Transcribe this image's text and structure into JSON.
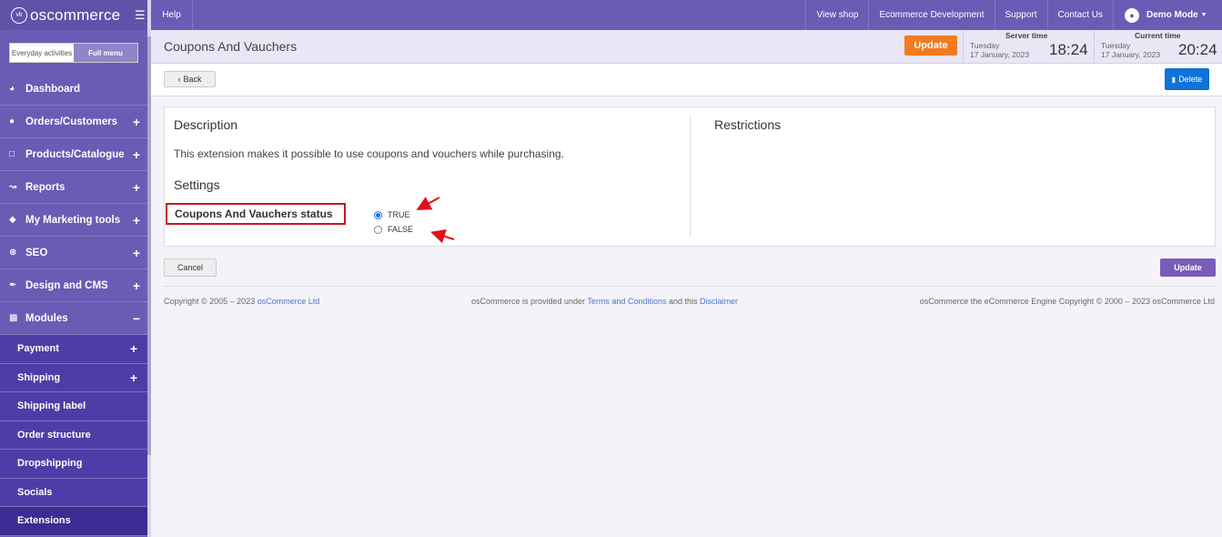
{
  "brand": {
    "name": "oscommerce",
    "logo_text": "vk"
  },
  "menu_toggle": {
    "everyday": "Everyday activities",
    "full": "Full menu"
  },
  "sidebar": {
    "items": [
      {
        "label": "Dashboard",
        "icon": "dashboard-icon",
        "expand": ""
      },
      {
        "label": "Orders/Customers",
        "icon": "users-icon",
        "expand": "+"
      },
      {
        "label": "Products/Catalogue",
        "icon": "folder-icon",
        "expand": "+"
      },
      {
        "label": "Reports",
        "icon": "chart-icon",
        "expand": "+"
      },
      {
        "label": "My Marketing tools",
        "icon": "tag-icon",
        "expand": "+"
      },
      {
        "label": "SEO",
        "icon": "sitemap-icon",
        "expand": "+"
      },
      {
        "label": "Design and CMS",
        "icon": "brush-icon",
        "expand": "+"
      },
      {
        "label": "Modules",
        "icon": "puzzle-icon",
        "expand": "−"
      }
    ],
    "subitems": [
      {
        "label": "Payment",
        "expand": "+"
      },
      {
        "label": "Shipping",
        "expand": "+"
      },
      {
        "label": "Shipping label",
        "expand": ""
      },
      {
        "label": "Order structure",
        "expand": ""
      },
      {
        "label": "Dropshipping",
        "expand": ""
      },
      {
        "label": "Socials",
        "expand": ""
      },
      {
        "label": "Extensions",
        "expand": ""
      }
    ]
  },
  "topbar": {
    "help": "Help",
    "links": [
      "View shop",
      "Ecommerce Development",
      "Support",
      "Contact Us"
    ],
    "user": "Demo Mode"
  },
  "header": {
    "title": "Coupons And Vauchers",
    "update": "Update",
    "server": {
      "label": "Server time",
      "day": "Tuesday",
      "date": "17 January, 2023",
      "time": "18:24"
    },
    "current": {
      "label": "Current time",
      "day": "Tuesday",
      "date": "17 January, 2023",
      "time": "20:24"
    }
  },
  "actions": {
    "back": "Back",
    "delete": "Delete"
  },
  "panel": {
    "description_title": "Description",
    "description": "This extension makes it possible to use coupons and vouchers while purchasing.",
    "settings_title": "Settings",
    "status_label": "Coupons And Vauchers status",
    "options": [
      {
        "label": "TRUE",
        "selected": true
      },
      {
        "label": "FALSE",
        "selected": false
      }
    ],
    "restrictions_title": "Restrictions"
  },
  "bottom": {
    "cancel": "Cancel",
    "update": "Update"
  },
  "footer": {
    "left_text": "Copyright © 2005 – 2023 ",
    "left_link": "osCommerce Ltd",
    "mid_text1": "osCommerce is provided under ",
    "mid_link1": "Terms and Conditions",
    "mid_text2": " and this ",
    "mid_link2": "Disclaimer",
    "right_text": "osCommerce the eCommerce Engine Copyright © 2000 – 2023 osCommerce Ltd"
  },
  "colors": {
    "primary": "#6a5bb5",
    "accent_orange": "#f47a20",
    "delete_blue": "#1172d8",
    "highlight_red": "#d0121b"
  }
}
